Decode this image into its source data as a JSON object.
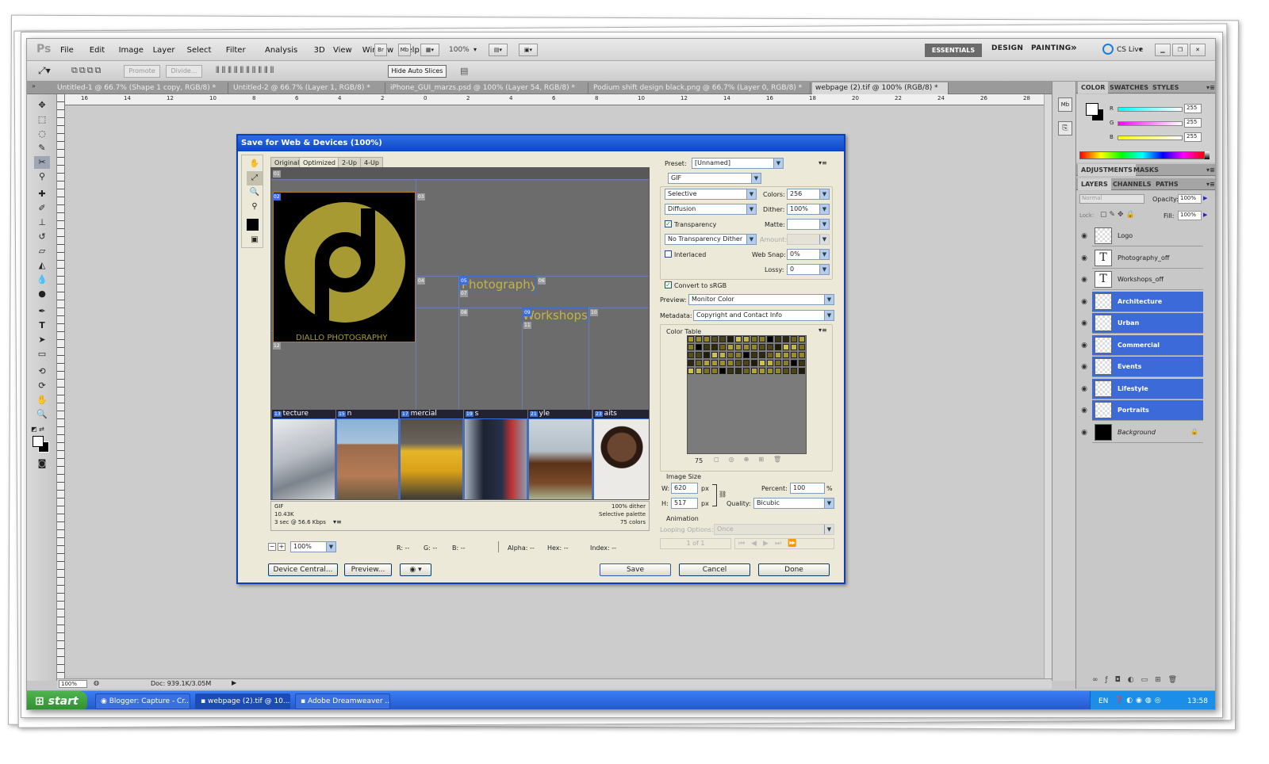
{
  "photoshop": {
    "logo": "Ps",
    "menu": [
      "File",
      "Edit",
      "Image",
      "Layer",
      "Select",
      "Filter",
      "Analysis",
      "3D",
      "View",
      "Window",
      "Help"
    ],
    "mini_buttons": [
      "Br",
      "Mb"
    ],
    "zoom_value": "100%",
    "workspaces": [
      "ESSENTIALS",
      "DESIGN",
      "PAINTING"
    ],
    "workspace_more": "»",
    "cslive": "CS Live",
    "options": {
      "promote": "Promote",
      "divide": "Divide...",
      "hide_auto": "Hide Auto Slices"
    },
    "doc_tabs": [
      "Untitled-1 @ 66.7% (Shape 1 copy, RGB/8) *",
      "Untitled-2 @ 66.7% (Layer 1, RGB/8) *",
      "iPhone_GUI_marzs.psd @ 100% (Layer 54, RGB/8) *",
      "Podium shift design black.png @ 66.7% (Layer 0, RGB/8) *",
      "webpage (2).tif @ 100% (RGB/8) *"
    ],
    "ruler_top": [
      "16",
      "14",
      "12",
      "10",
      "8",
      "6",
      "4",
      "2",
      "0",
      "2",
      "4",
      "6",
      "8",
      "10",
      "12",
      "14",
      "16",
      "18",
      "20",
      "22",
      "24",
      "26",
      "28"
    ],
    "status": {
      "zoom": "100%",
      "doc": "Doc: 939.1K/3.05M"
    }
  },
  "dialog": {
    "title": "Save for Web & Devices (100%)",
    "view_tabs": [
      "Original",
      "Optimized",
      "2-Up",
      "4-Up"
    ],
    "slices": {
      "s01": "01",
      "s02": "02",
      "s03": "03",
      "s04": "04",
      "s05": "05",
      "s06": "06",
      "s07": "07",
      "s08": "08",
      "s09": "09",
      "s10": "10",
      "s11": "11",
      "s12": "12",
      "s13": "13",
      "s15": "15",
      "s17": "17",
      "s19": "19",
      "s21": "21",
      "s23": "23"
    },
    "logo_caption": "DIALLO PHOTOGRAPHY",
    "nav_photography": "Photography",
    "nav_workshops": "Workshops",
    "captions": [
      "tecture",
      "n",
      "mercial",
      "s",
      "yle",
      "aits"
    ],
    "info_left": [
      "GIF",
      "10.43K",
      "3 sec @ 56.6 Kbps"
    ],
    "info_right": [
      "100% dither",
      "Selective palette",
      "75 colors"
    ],
    "bottom": {
      "zoom": "100%",
      "r": "R: --",
      "g": "G: --",
      "b": "B: --",
      "alpha": "Alpha: --",
      "hex": "Hex: --",
      "index": "Index: --"
    },
    "buttons": {
      "device_central": "Device Central...",
      "preview": "Preview...",
      "save": "Save",
      "cancel": "Cancel",
      "done": "Done"
    },
    "settings": {
      "preset_label": "Preset:",
      "preset_value": "[Unnamed]",
      "format": "GIF",
      "reduction": "Selective",
      "colors_label": "Colors:",
      "colors": "256",
      "dither_algo": "Diffusion",
      "dither_label": "Dither:",
      "dither": "100%",
      "transparency": "Transparency",
      "matte_label": "Matte:",
      "trans_dither": "No Transparency Dither",
      "amount_label": "Amount:",
      "interlaced": "Interlaced",
      "websnap_label": "Web Snap:",
      "websnap": "0%",
      "lossy_label": "Lossy:",
      "lossy": "0",
      "convert_srgb": "Convert to sRGB",
      "preview_label": "Preview:",
      "preview_value": "Monitor Color",
      "metadata_label": "Metadata:",
      "metadata_value": "Copyright and Contact Info",
      "color_table_label": "Color Table",
      "color_count": "75",
      "image_size_label": "Image Size",
      "w_label": "W:",
      "w": "620",
      "h_label": "H:",
      "h": "517",
      "px": "px",
      "percent_label": "Percent:",
      "percent": "100",
      "pct": "%",
      "quality_label": "Quality:",
      "quality": "Bicubic",
      "animation_label": "Animation",
      "looping_label": "Looping Options:",
      "looping": "Once",
      "frame": "1 of 1"
    }
  },
  "panels": {
    "color_tabs": [
      "COLOR",
      "SWATCHES",
      "STYLES"
    ],
    "rgb": [
      {
        "k": "R",
        "v": "255"
      },
      {
        "k": "G",
        "v": "255"
      },
      {
        "k": "B",
        "v": "255"
      }
    ],
    "adj_tabs": [
      "ADJUSTMENTS",
      "MASKS"
    ],
    "layer_tabs": [
      "LAYERS",
      "CHANNELS",
      "PATHS"
    ],
    "blend": "Normal",
    "opacity_label": "Opacity:",
    "opacity": "100%",
    "lock_label": "Lock:",
    "fill_label": "Fill:",
    "fill": "100%",
    "layers": [
      {
        "name": "Logo",
        "type": "img",
        "sel": false
      },
      {
        "name": "Photography_off",
        "type": "text",
        "sel": false
      },
      {
        "name": "Workshops_off",
        "type": "text",
        "sel": false
      },
      {
        "name": "Architecture",
        "type": "img",
        "sel": true
      },
      {
        "name": "Urban",
        "type": "img",
        "sel": true
      },
      {
        "name": "Commercial",
        "type": "img",
        "sel": true
      },
      {
        "name": "Events",
        "type": "img",
        "sel": true
      },
      {
        "name": "Lifestyle",
        "type": "img",
        "sel": true
      },
      {
        "name": "Portraits",
        "type": "img",
        "sel": true
      },
      {
        "name": "Background",
        "type": "bg",
        "sel": false
      }
    ]
  },
  "taskbar": {
    "start": "start",
    "items": [
      {
        "label": "Blogger: Capture - Cr...",
        "icon": "chrome"
      },
      {
        "label": "webpage (2).tif @ 10...",
        "icon": "photoshop"
      },
      {
        "label": "Adobe Dreamweaver ...",
        "icon": "dreamweaver"
      }
    ],
    "lang": "EN",
    "clock": "13:58"
  },
  "colors": {
    "gold": "#a89a32",
    "select_blue": "#3c6ad8",
    "xp_blue": "#0a47c8"
  }
}
